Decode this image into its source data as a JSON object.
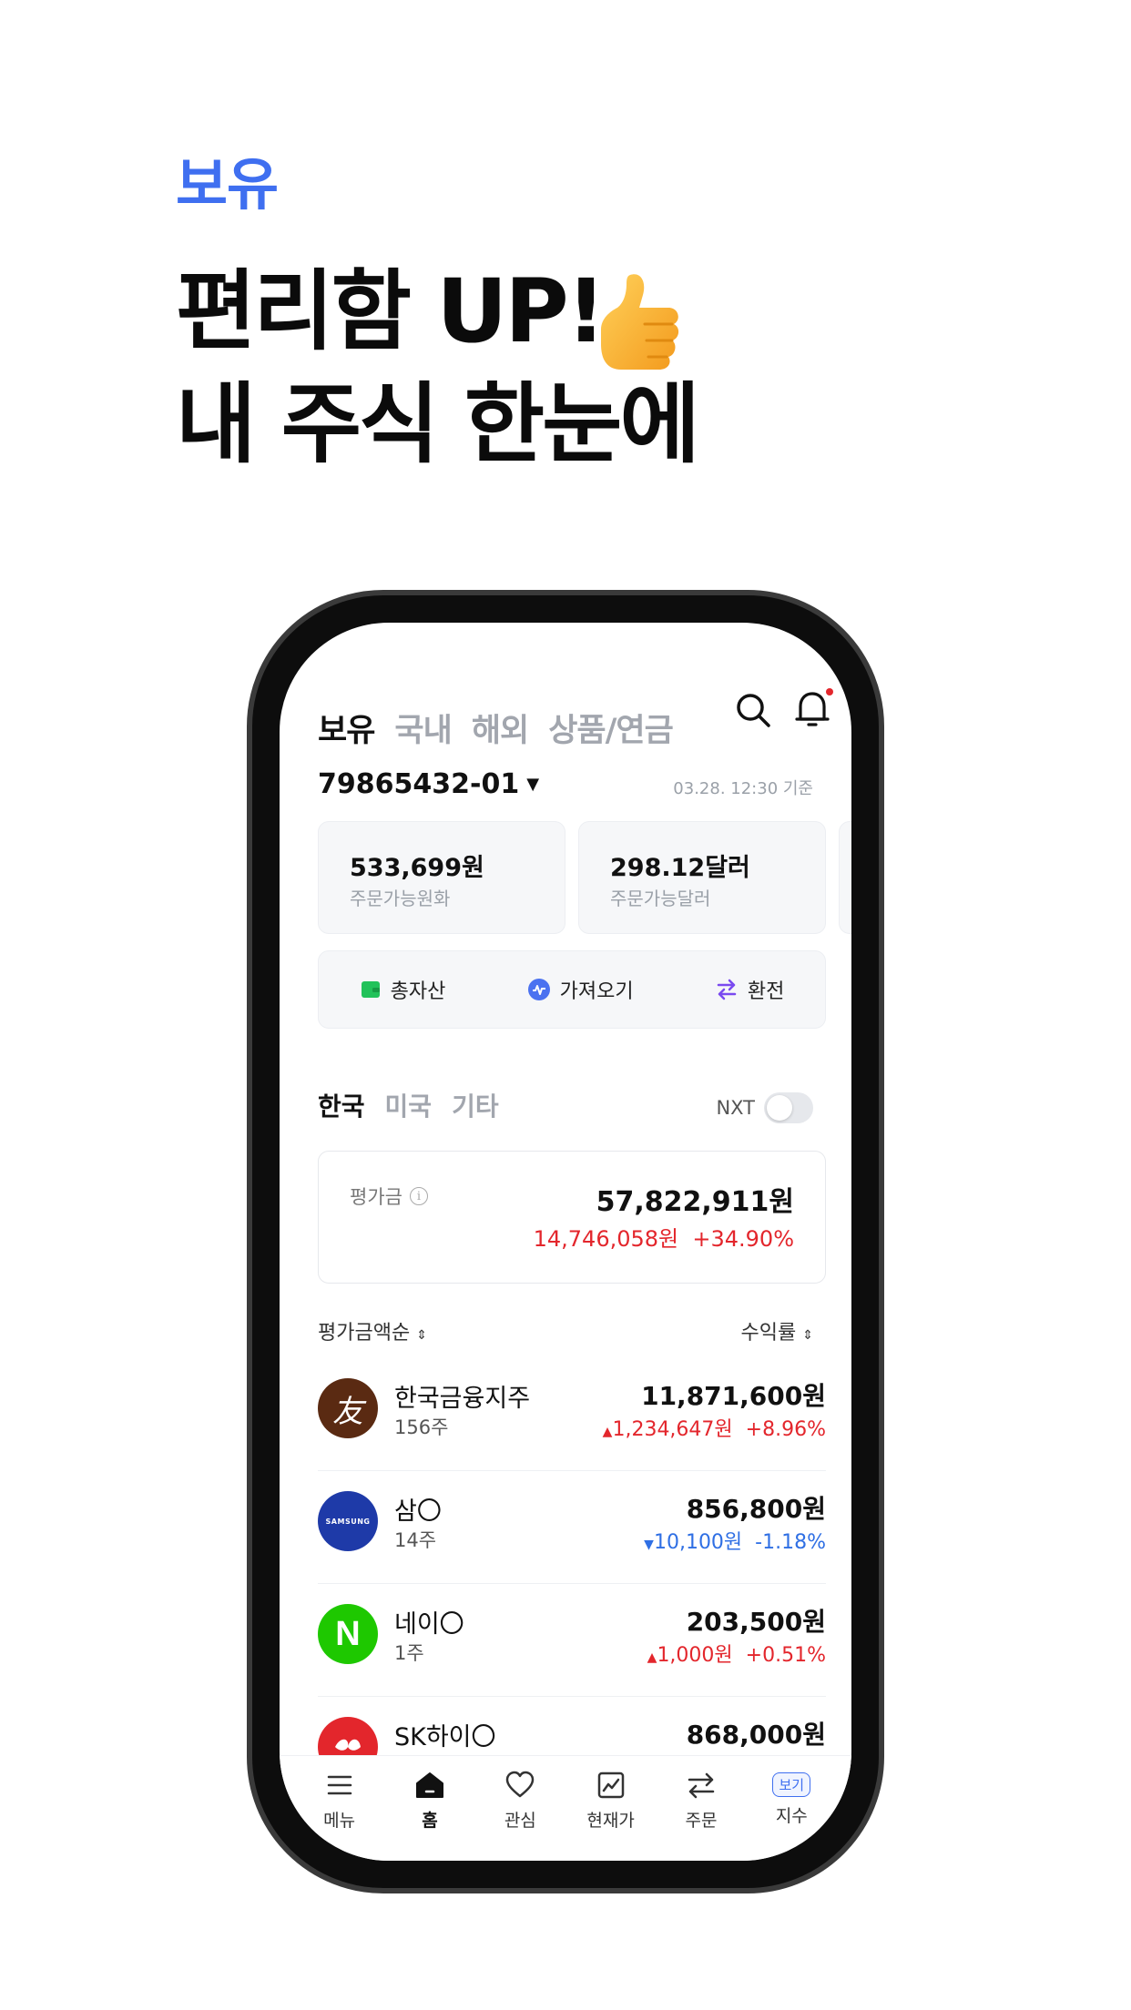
{
  "promo": {
    "label": "보유",
    "title_line1": "편리함 UP!",
    "title_line2": "내 주식 한눈에",
    "emoji_icon": "thumbs-up-icon"
  },
  "app": {
    "tabs": [
      "보유",
      "국내",
      "해외",
      "상품/연금"
    ],
    "active_tab": "보유",
    "account": "79865432-01",
    "timestamp": "03.28. 12:30 기준",
    "cards": [
      {
        "value": "533,699원",
        "label": "주문가능원화"
      },
      {
        "value": "298.12달러",
        "label": "주문가능달러"
      }
    ],
    "actions": [
      {
        "label": "총자산",
        "icon": "wallet-icon",
        "color": "#22c25a"
      },
      {
        "label": "가져오기",
        "icon": "import-icon",
        "color": "#4b72f0"
      },
      {
        "label": "환전",
        "icon": "exchange-icon",
        "color": "#7a4af0"
      }
    ],
    "market_tabs": [
      "한국",
      "미국",
      "기타"
    ],
    "nxt_label": "NXT",
    "nxt_on": false,
    "evaluation": {
      "label": "평가금",
      "value": "57,822,911원",
      "profit": "14,746,058원",
      "rate": "+34.90%"
    },
    "sort": {
      "left": "평가금액순",
      "right": "수익률"
    },
    "holdings": [
      {
        "name": "한국금융지주",
        "qty": "156주",
        "amount": "11,871,600원",
        "change": "1,234,647원",
        "rate": "+8.96%",
        "direction": "up",
        "logo_color": "#5a2a12",
        "logo_text": "友"
      },
      {
        "name": "삼〇",
        "qty": "14주",
        "amount": "856,800원",
        "change": "10,100원",
        "rate": "-1.18%",
        "direction": "down",
        "logo_color": "#1e3aa8",
        "logo_text": "SAMSUNG"
      },
      {
        "name": "네이〇",
        "qty": "1주",
        "amount": "203,500원",
        "change": "1,000원",
        "rate": "+0.51%",
        "direction": "up",
        "logo_color": "#1ec800",
        "logo_text": "N"
      },
      {
        "name": "SK하이〇",
        "qty": "",
        "amount": "868,000원",
        "change": "",
        "rate": "",
        "direction": "up",
        "logo_color": "#e3262c",
        "logo_text": ""
      }
    ],
    "bottom_nav": [
      {
        "label": "메뉴",
        "icon": "menu-icon"
      },
      {
        "label": "홈",
        "icon": "home-icon"
      },
      {
        "label": "관심",
        "icon": "heart-icon"
      },
      {
        "label": "현재가",
        "icon": "chart-icon"
      },
      {
        "label": "주문",
        "icon": "transfer-icon"
      },
      {
        "label": "지수",
        "icon": "view-badge",
        "badge": "보기"
      }
    ],
    "accent": "#3f6ff0",
    "up_color": "#e3262c",
    "down_color": "#2f6fe4"
  }
}
